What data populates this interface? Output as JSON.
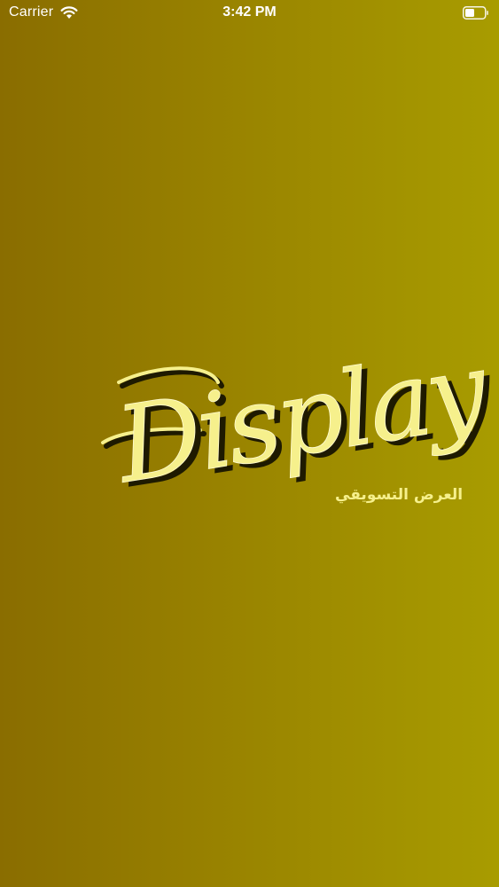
{
  "status_bar": {
    "carrier": "Carrier",
    "time": "3:42 PM",
    "wifi_icon": "wifi-icon",
    "battery_icon": "battery-icon"
  },
  "splash": {
    "logo_wordmark": "Display",
    "logo_tagline": "العرض التسويقي",
    "colors": {
      "background_left": "#8a6d00",
      "background_right": "#a89c00",
      "logo_fill": "#f6f08c",
      "logo_shadow": "#1e1a00"
    }
  }
}
